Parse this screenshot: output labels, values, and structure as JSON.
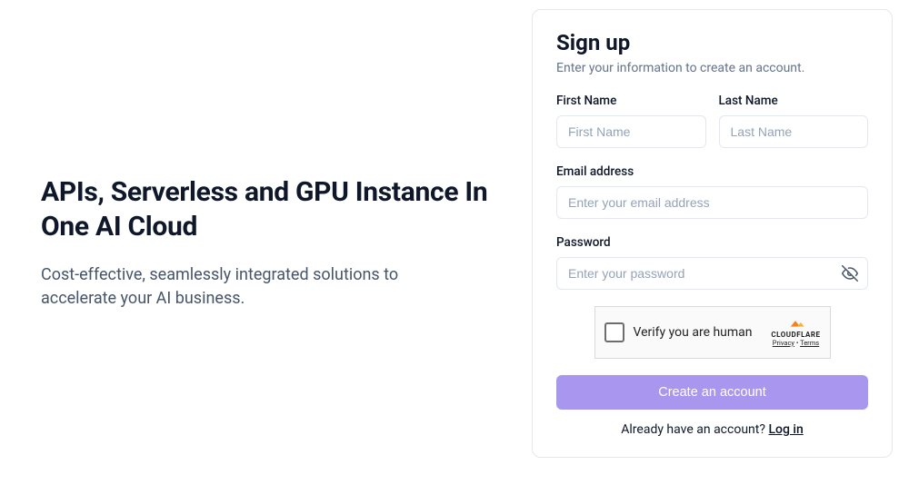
{
  "hero": {
    "headline": "APIs, Serverless and GPU Instance In One AI Cloud",
    "subheadline": "Cost-effective, seamlessly integrated solutions to accelerate your AI business."
  },
  "form": {
    "title": "Sign up",
    "subtitle": "Enter your information to create an account.",
    "first_name": {
      "label": "First Name",
      "placeholder": "First Name",
      "value": ""
    },
    "last_name": {
      "label": "Last Name",
      "placeholder": "Last Name",
      "value": ""
    },
    "email": {
      "label": "Email address",
      "placeholder": "Enter your email address",
      "value": ""
    },
    "password": {
      "label": "Password",
      "placeholder": "Enter your password",
      "value": ""
    },
    "captcha": {
      "prompt": "Verify you are human",
      "brand": "CLOUDFLARE",
      "privacy": "Privacy",
      "terms": "Terms"
    },
    "submit_label": "Create an account",
    "login_prompt": "Already have an account? ",
    "login_link": "Log in"
  }
}
